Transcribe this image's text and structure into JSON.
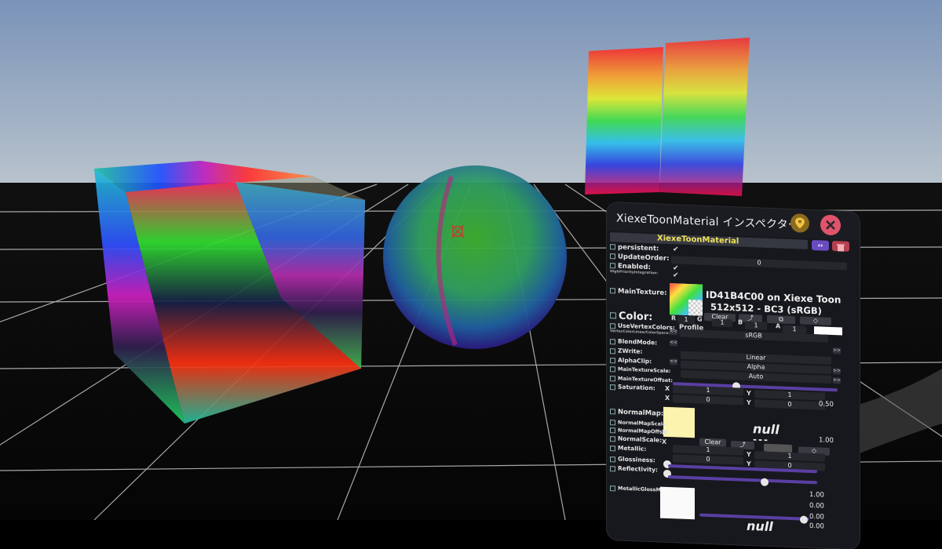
{
  "inspector": {
    "title": "XiexeToonMaterial インスペクター",
    "component_name": "XiexeToonMaterial",
    "fields": {
      "persistent": "persistent:",
      "update_order": "UpdateOrder:",
      "update_order_value": "0",
      "enabled": "Enabled:",
      "high_priority": "HighPriorityIntegration:",
      "main_texture": "MainTexture:",
      "texture_info_line1": "ID41B4C00 on Xiexe Toon",
      "texture_info_line2": "512x512 - BC3 (sRGB)",
      "clear": "Clear",
      "profile": "Profile",
      "profile_value": "sRGB",
      "r": "R",
      "r_value": "1",
      "g": "G",
      "g_value": "1",
      "b": "B",
      "b_value": "1",
      "a": "A",
      "a_value": "1",
      "color": "Color:",
      "use_vertex_colors": "UseVertexColors:",
      "vertex_color_lin": "VertexColorLinearColorSpace:",
      "blend_mode": "BlendMode:",
      "z_write": "ZWrite:",
      "z_write_value": "Linear",
      "alpha_clip": "AlphaClip:",
      "alpha_clip_value": "Alpha",
      "main_texture_scale": "MainTextureScale:",
      "main_texture_scale_value": "Auto",
      "main_texture_offset": "MainTextureOffset:",
      "saturation": "Saturation:",
      "x": "X",
      "y": "Y",
      "scale_x": "1",
      "scale_y": "1",
      "offset_x": "0",
      "offset_y": "0",
      "saturation_value": "0.50",
      "normal_map": "NormalMap:",
      "null": "null",
      "dashes": "---",
      "normal_map_scale": "NormalMapScale:",
      "normal_map_offset": "NormalMapOffset:",
      "normal_scale": "NormalScale:",
      "metallic": "Metallic:",
      "glossiness": "Glossiness:",
      "reflectivity": "Reflectivity:",
      "normal_scale_value": "1.00",
      "nm_scale_x": "1",
      "nm_scale_y": "1",
      "nm_offset_x": "0",
      "nm_offset_y": "0",
      "metallic_gloss_map": "MetallicGlossMap:",
      "metallic_value": "1.00",
      "glossiness_value": "0.00",
      "reflectivity_value": "0.00",
      "slider_value_extra": "0.00"
    },
    "colors": {
      "panel_bg": "#17181d",
      "component_header_bg": "#363841",
      "component_name_color": "#f1e35c",
      "accent_purple": "#5a3fa2",
      "close_red": "#e0546b",
      "pin_amber": "#8a6a1e"
    },
    "icons": [
      "pin-icon",
      "close-icon",
      "move-icon",
      "trash-icon",
      "center-cursor-icon"
    ]
  }
}
